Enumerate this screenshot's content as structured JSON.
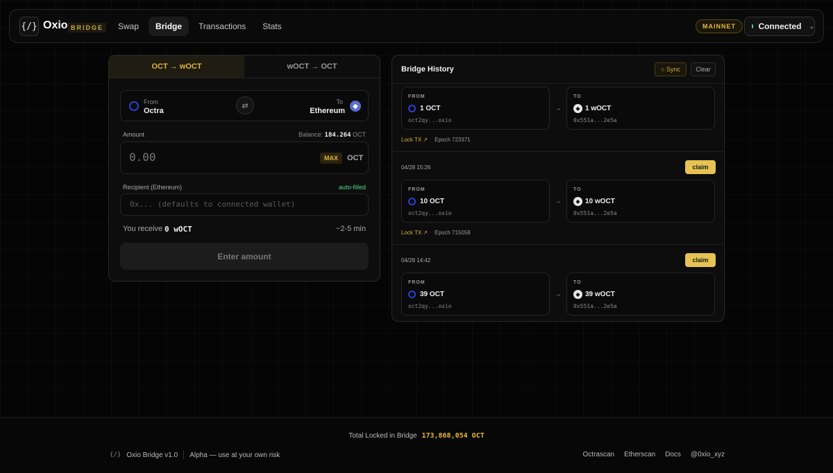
{
  "header": {
    "logo_glyph": "{/}",
    "brand": "Oxio",
    "brand_tag": "BRIDGE",
    "nav": [
      {
        "label": "Swap",
        "active": false
      },
      {
        "label": "Bridge",
        "active": true
      },
      {
        "label": "Transactions",
        "active": false
      },
      {
        "label": "Stats",
        "active": false
      }
    ],
    "network": "MAINNET",
    "wallet_status": "Connected"
  },
  "bridge": {
    "tabs": [
      {
        "label": "OCT → wOCT",
        "active": true
      },
      {
        "label": "wOCT → OCT",
        "active": false
      }
    ],
    "from_label": "From",
    "from_chain": "Octra",
    "to_label": "To",
    "to_chain": "Ethereum",
    "amount_label": "Amount",
    "balance_label": "Balance:",
    "balance_value": "184.264",
    "balance_unit": "OCT",
    "amount_placeholder": "0.00",
    "max_label": "MAX",
    "amount_unit": "OCT",
    "recipient_label": "Recipient (Ethereum)",
    "recipient_status": "auto-filled",
    "recipient_placeholder": "0x... (defaults to connected wallet)",
    "receive_label": "You receive",
    "receive_value": "0 wOCT",
    "eta": "~2-5 min",
    "submit_label": "Enter amount"
  },
  "history": {
    "title": "Bridge History",
    "sync_label": "○ Sync",
    "clear_label": "Clear",
    "from_label": "FROM",
    "to_label": "TO",
    "lock_tx_label": "Lock TX ↗",
    "claim_label": "claim",
    "entries": [
      {
        "timestamp": "",
        "from_amount": "1 OCT",
        "from_addr": "oct2qy...oxio",
        "to_amount": "1 wOCT",
        "to_addr": "0x551a...2e5a",
        "epoch": "Epoch 723371",
        "claimable": false
      },
      {
        "timestamp": "04/28 15:26",
        "from_amount": "10 OCT",
        "from_addr": "oct2qy...oxio",
        "to_amount": "10 wOCT",
        "to_addr": "0x551a...2e5a",
        "epoch": "Epoch 715058",
        "claimable": true
      },
      {
        "timestamp": "04/28 14:42",
        "from_amount": "39 OCT",
        "from_addr": "oct2qy...oxio",
        "to_amount": "39 wOCT",
        "to_addr": "0x551a...2e5a",
        "epoch": "",
        "claimable": true
      }
    ]
  },
  "footer": {
    "locked_label": "Total Locked in Bridge",
    "locked_value": "173,868,054 OCT",
    "version": "Oxio Bridge v1.0",
    "disclaimer": "Alpha — use at your own risk",
    "links": [
      "Octrascan",
      "Etherscan",
      "Docs",
      "@0xio_xyz"
    ]
  },
  "colors": {
    "accent": "#e0b53c",
    "connected": "#4ade80",
    "octra": "#2b3fd6"
  }
}
